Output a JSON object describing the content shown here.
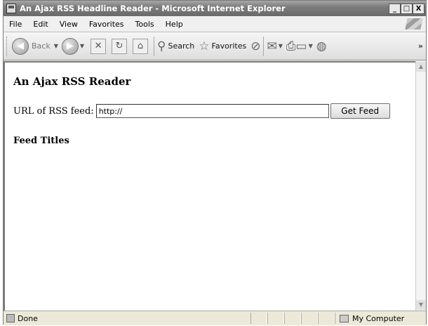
{
  "window": {
    "title": "An Ajax RSS Headline Reader - Microsoft Internet Explorer",
    "controls": {
      "minimize": "_",
      "maximize": "□",
      "close": "X"
    }
  },
  "menu": {
    "items": [
      {
        "label": "File"
      },
      {
        "label": "Edit"
      },
      {
        "label": "View"
      },
      {
        "label": "Favorites"
      },
      {
        "label": "Tools"
      },
      {
        "label": "Help"
      }
    ]
  },
  "toolbar": {
    "back_label": "Back",
    "search_label": "Search",
    "favorites_label": "Favorites",
    "overflow": "»"
  },
  "page": {
    "heading": "An Ajax RSS Reader",
    "url_label": "URL of RSS feed:",
    "url_value": "http://",
    "get_button": "Get Feed",
    "feed_titles_heading": "Feed Titles"
  },
  "status": {
    "text": "Done",
    "zone": "My Computer"
  }
}
